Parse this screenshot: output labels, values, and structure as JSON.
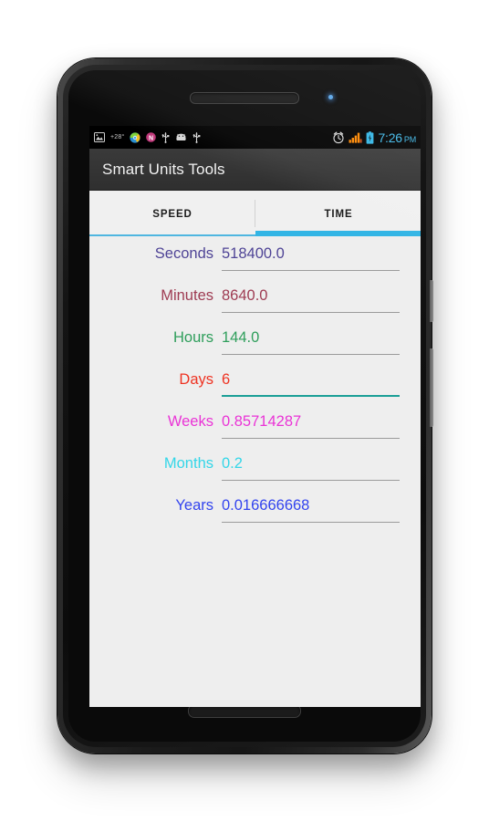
{
  "device": {
    "name": "android-phone",
    "earpiece_icon": "speaker-grille-icon",
    "led_icon": "notification-led-icon",
    "power_button": "power-button",
    "volume_button": "volume-rocker-button",
    "bottom_speaker_icon": "speaker-grille-icon"
  },
  "status_bar": {
    "background": "#000000",
    "left_icons": [
      {
        "name": "screenshot-icon",
        "glyph": "image"
      },
      {
        "name": "weather-temperature-indicator",
        "label": "+28°"
      },
      {
        "name": "browser-icon",
        "glyph": "globe"
      },
      {
        "name": "notes-app-icon",
        "label": "N"
      },
      {
        "name": "usb-debugging-icon",
        "glyph": "usb"
      },
      {
        "name": "android-system-icon",
        "glyph": "android"
      },
      {
        "name": "usb-connected-icon",
        "glyph": "usb"
      }
    ],
    "right_icons": [
      {
        "name": "alarm-icon",
        "glyph": "alarm"
      },
      {
        "name": "signal-strength-icon",
        "glyph": "signal-bars",
        "color": "#ff8800"
      },
      {
        "name": "battery-icon",
        "glyph": "battery",
        "color": "#33b5e5"
      }
    ],
    "clock": "7:26",
    "clock_ampm": "PM",
    "clock_color": "#3fb8e8"
  },
  "action_bar": {
    "title": "Smart Units Tools",
    "background": "#353535",
    "title_color": "#f2f2f2"
  },
  "tabs": {
    "active_index": 1,
    "active_indicator_color": "#33b5e5",
    "inactive_indicator_color": "#4fb6e0",
    "items": [
      {
        "name": "tab-speed",
        "label": "SPEED"
      },
      {
        "name": "tab-time",
        "label": "TIME"
      }
    ]
  },
  "converter": {
    "focused_row_index": 3,
    "focused_underline_color": "#1a9e96",
    "rows": [
      {
        "name": "row-seconds",
        "label": "Seconds",
        "value": "518400.0",
        "color": "#4f4496",
        "focused": false
      },
      {
        "name": "row-minutes",
        "label": "Minutes",
        "value": "8640.0",
        "color": "#9e3b52",
        "focused": false
      },
      {
        "name": "row-hours",
        "label": "Hours",
        "value": "144.0",
        "color": "#2e9e5b",
        "focused": false
      },
      {
        "name": "row-days",
        "label": "Days",
        "value": "6",
        "color": "#ee3322",
        "focused": true
      },
      {
        "name": "row-weeks",
        "label": "Weeks",
        "value": "0.85714287",
        "color": "#ea33d6",
        "focused": false
      },
      {
        "name": "row-months",
        "label": "Months",
        "value": "0.2",
        "color": "#33d6e8",
        "focused": false
      },
      {
        "name": "row-years",
        "label": "Years",
        "value": "0.016666668",
        "color": "#3344ee",
        "focused": false
      }
    ]
  },
  "screen": {
    "background": "#eeeeee"
  }
}
